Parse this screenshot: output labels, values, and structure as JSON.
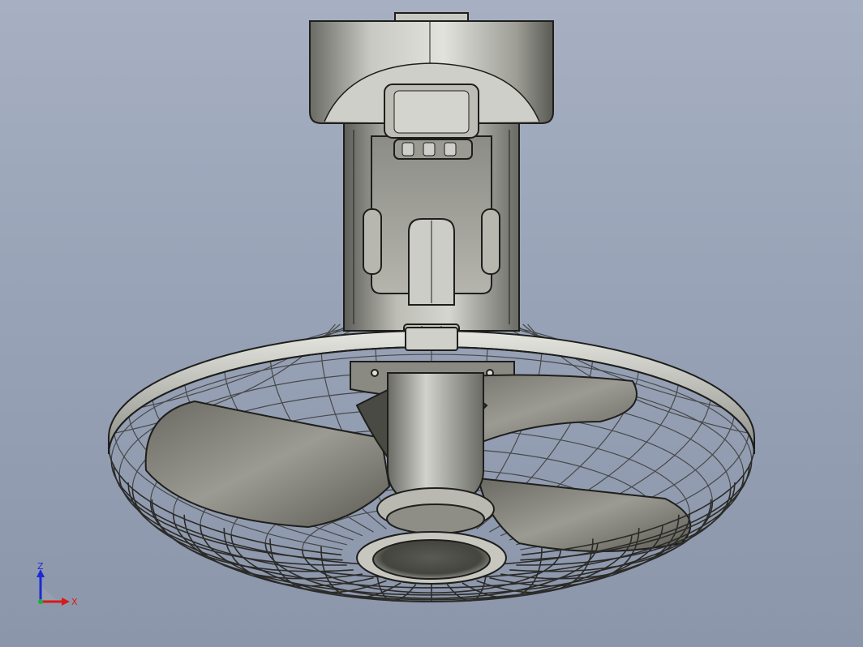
{
  "view": {
    "background_top": "#a7b0c2",
    "background_bottom": "#8c96aa"
  },
  "model": {
    "icon": "ceiling-fan-model",
    "metal_light": "#d9d9d4",
    "metal_mid": "#a9a9a2",
    "metal_dark": "#55554f",
    "edge": "#1e1e1c",
    "blade_count": 3,
    "grille_meridians": 36,
    "grille_rings": 9
  },
  "triad": {
    "z_label": "Z",
    "x_label": "X",
    "z_color": "#1a2ad8",
    "x_color": "#d81a1a",
    "y_color": "#1ab03a"
  }
}
